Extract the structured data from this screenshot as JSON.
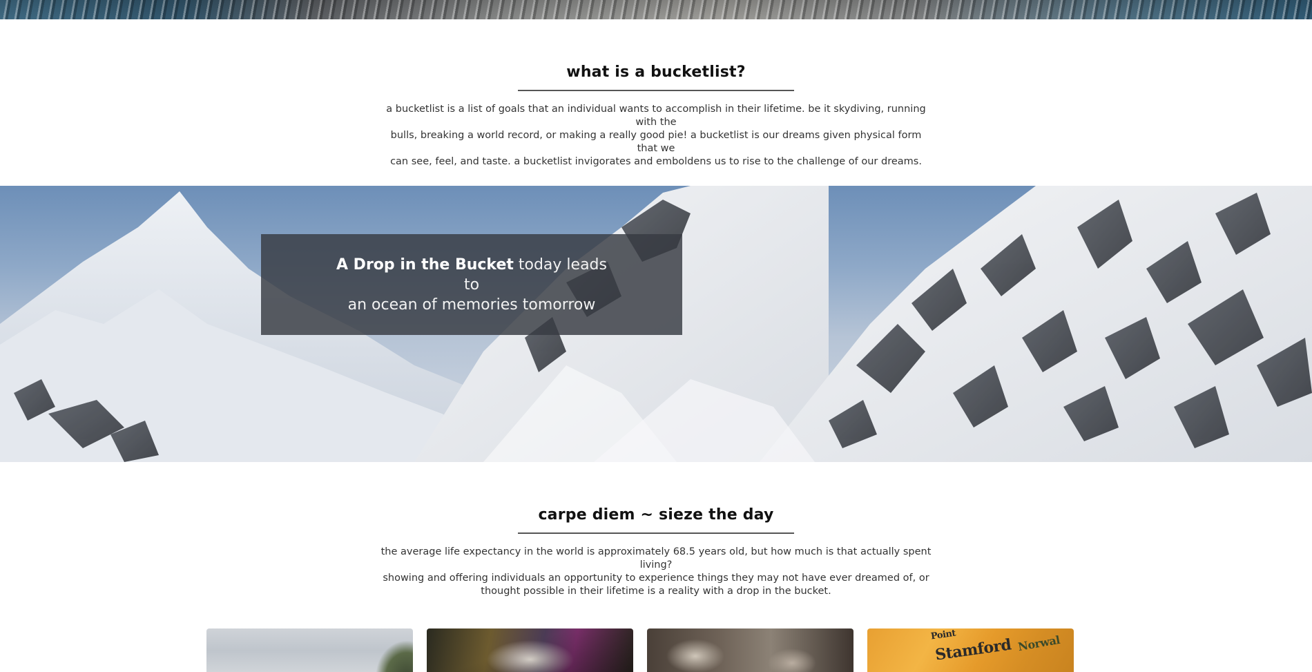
{
  "sections": {
    "what": {
      "title": "what is a bucketlist?",
      "lines": [
        "a bucketlist is a list of goals that an individual wants to accomplish in their lifetime. be it skydiving, running with the",
        "bulls, breaking a world record, or making a really good pie! a bucketlist is our dreams given physical form that we",
        "can see, feel, and taste. a bucketlist invigorates and emboldens us to rise to the challenge of our dreams."
      ]
    },
    "carpe": {
      "title": "carpe diem ~ sieze the day",
      "lines": [
        "the average life expectancy in the world is approximately 68.5 years old, but how much is that actually spent living?",
        "showing and offering individuals an opportunity to experience things they may not have ever dreamed of, or",
        "thought possible in their lifetime is a reality with a drop in the bucket."
      ]
    }
  },
  "banner": {
    "quote_strong": "A Drop in the Bucket",
    "quote_rest_1": " today leads to",
    "quote_rest_2": "an ocean of memories tomorrow"
  },
  "cards": {
    "map_labels": [
      "Point",
      "Stamford",
      "Norwal"
    ]
  }
}
